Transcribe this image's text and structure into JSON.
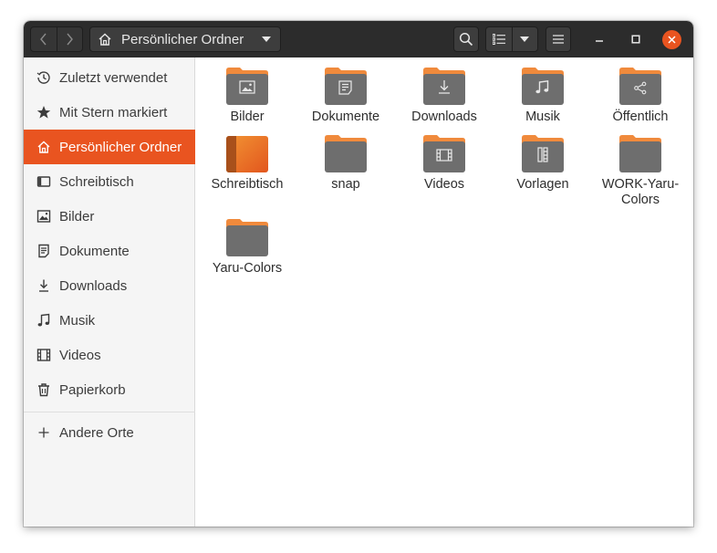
{
  "header": {
    "path_label": "Persönlicher Ordner"
  },
  "sidebar": {
    "items": [
      {
        "label": "Zuletzt verwendet",
        "icon": "clock-icon"
      },
      {
        "label": "Mit Stern markiert",
        "icon": "star-icon"
      },
      {
        "label": "Persönlicher Ordner",
        "icon": "home-icon",
        "active": true
      },
      {
        "label": "Schreibtisch",
        "icon": "desktop-icon"
      },
      {
        "label": "Bilder",
        "icon": "image-icon"
      },
      {
        "label": "Dokumente",
        "icon": "document-icon"
      },
      {
        "label": "Downloads",
        "icon": "download-icon"
      },
      {
        "label": "Musik",
        "icon": "music-icon"
      },
      {
        "label": "Videos",
        "icon": "film-icon"
      },
      {
        "label": "Papierkorb",
        "icon": "trash-icon"
      }
    ],
    "other_places": "Andere Orte"
  },
  "files": [
    {
      "name": "Bilder",
      "emblem": "image"
    },
    {
      "name": "Dokumente",
      "emblem": "document"
    },
    {
      "name": "Downloads",
      "emblem": "download"
    },
    {
      "name": "Musik",
      "emblem": "music"
    },
    {
      "name": "Öffentlich",
      "emblem": "share"
    },
    {
      "name": "Schreibtisch",
      "emblem": "desktop"
    },
    {
      "name": "snap",
      "emblem": "none"
    },
    {
      "name": "Videos",
      "emblem": "film"
    },
    {
      "name": "Vorlagen",
      "emblem": "template"
    },
    {
      "name": "WORK-Yaru-Colors",
      "emblem": "none"
    },
    {
      "name": "Yaru-Colors",
      "emblem": "none"
    }
  ],
  "colors": {
    "accent": "#e95420",
    "folder_tab": "#f08a3c",
    "folder_body": "#6e6e6e",
    "headerbar": "#2c2c2c"
  }
}
